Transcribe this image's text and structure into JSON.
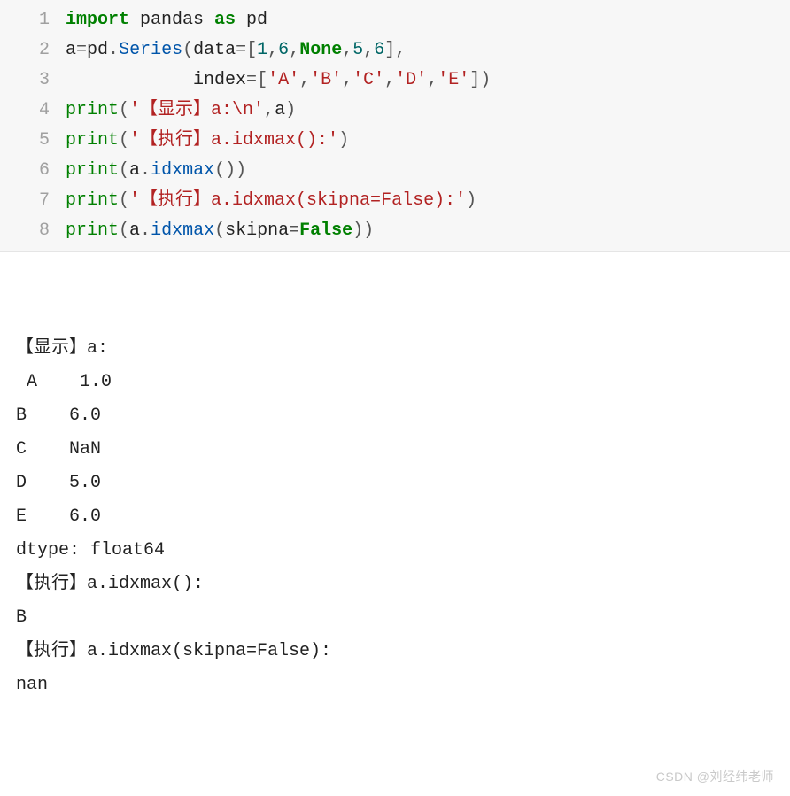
{
  "code": {
    "lines": [
      {
        "n": "1",
        "tokens": [
          [
            "kw-import",
            "import"
          ],
          [
            "ident-n",
            " pandas "
          ],
          [
            "kw-as",
            "as"
          ],
          [
            "ident-n",
            " pd"
          ]
        ]
      },
      {
        "n": "2",
        "tokens": [
          [
            "ident-n",
            "a"
          ],
          [
            "punct",
            "="
          ],
          [
            "ident-n",
            "pd"
          ],
          [
            "punct",
            "."
          ],
          [
            "attr",
            "Series"
          ],
          [
            "punct",
            "("
          ],
          [
            "ident-n",
            "data"
          ],
          [
            "punct",
            "="
          ],
          [
            "punct",
            "["
          ],
          [
            "num",
            "1"
          ],
          [
            "punct",
            ","
          ],
          [
            "num",
            "6"
          ],
          [
            "punct",
            ","
          ],
          [
            "kw-none",
            "None"
          ],
          [
            "punct",
            ","
          ],
          [
            "num",
            "5"
          ],
          [
            "punct",
            ","
          ],
          [
            "num",
            "6"
          ],
          [
            "punct",
            "],"
          ]
        ]
      },
      {
        "n": "3",
        "tokens": [
          [
            "ident-n",
            "            index"
          ],
          [
            "punct",
            "="
          ],
          [
            "punct",
            "["
          ],
          [
            "str",
            "'A'"
          ],
          [
            "punct",
            ","
          ],
          [
            "str",
            "'B'"
          ],
          [
            "punct",
            ","
          ],
          [
            "str",
            "'C'"
          ],
          [
            "punct",
            ","
          ],
          [
            "str",
            "'D'"
          ],
          [
            "punct",
            ","
          ],
          [
            "str",
            "'E'"
          ],
          [
            "punct",
            "])"
          ]
        ]
      },
      {
        "n": "4",
        "tokens": [
          [
            "func",
            "print"
          ],
          [
            "punct",
            "("
          ],
          [
            "str",
            "'【显示】a:\\n'"
          ],
          [
            "punct",
            ","
          ],
          [
            "ident-n",
            "a"
          ],
          [
            "punct",
            ")"
          ]
        ]
      },
      {
        "n": "5",
        "tokens": [
          [
            "func",
            "print"
          ],
          [
            "punct",
            "("
          ],
          [
            "str",
            "'【执行】a.idxmax():'"
          ],
          [
            "punct",
            ")"
          ]
        ]
      },
      {
        "n": "6",
        "tokens": [
          [
            "func",
            "print"
          ],
          [
            "punct",
            "("
          ],
          [
            "ident-n",
            "a"
          ],
          [
            "punct",
            "."
          ],
          [
            "attr",
            "idxmax"
          ],
          [
            "punct",
            "())"
          ]
        ]
      },
      {
        "n": "7",
        "tokens": [
          [
            "func",
            "print"
          ],
          [
            "punct",
            "("
          ],
          [
            "str",
            "'【执行】a.idxmax(skipna=False):'"
          ],
          [
            "punct",
            ")"
          ]
        ]
      },
      {
        "n": "8",
        "tokens": [
          [
            "func",
            "print"
          ],
          [
            "punct",
            "("
          ],
          [
            "ident-n",
            "a"
          ],
          [
            "punct",
            "."
          ],
          [
            "attr",
            "idxmax"
          ],
          [
            "punct",
            "("
          ],
          [
            "ident-n",
            "skipna"
          ],
          [
            "punct",
            "="
          ],
          [
            "kw-false",
            "False"
          ],
          [
            "punct",
            "))"
          ]
        ]
      }
    ]
  },
  "output": {
    "lines": [
      "【显示】a:",
      " A    1.0",
      "B    6.0",
      "C    NaN",
      "D    5.0",
      "E    6.0",
      "dtype: float64",
      "【执行】a.idxmax():",
      "B",
      "【执行】a.idxmax(skipna=False):",
      "nan"
    ]
  },
  "watermark": "CSDN @刘经纬老师"
}
